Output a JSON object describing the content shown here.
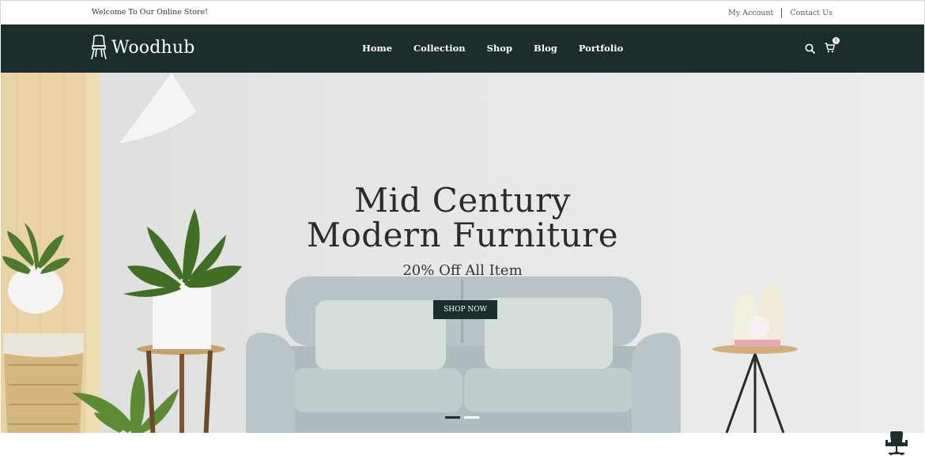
{
  "topbar": {
    "welcome": "Welcome To Our Online Store!",
    "my_account": "My Account",
    "contact_us": "Contact Us"
  },
  "header": {
    "logo_text": "Woodhub",
    "nav": [
      "Home",
      "Collection",
      "Shop",
      "Blog",
      "Portfolio"
    ],
    "cart_count": "0"
  },
  "hero": {
    "title_line1": "Mid Century",
    "title_line2": "Modern Furniture",
    "subtitle": "20% Off All Item",
    "button": "SHOP NOW",
    "slides": 2,
    "active_slide": 1
  },
  "colors": {
    "brand_dark": "#1b2d2d",
    "sofa": "#b9c4c8"
  },
  "icons": [
    "chair-logo-icon",
    "search-icon",
    "cart-icon",
    "chair-icon"
  ]
}
